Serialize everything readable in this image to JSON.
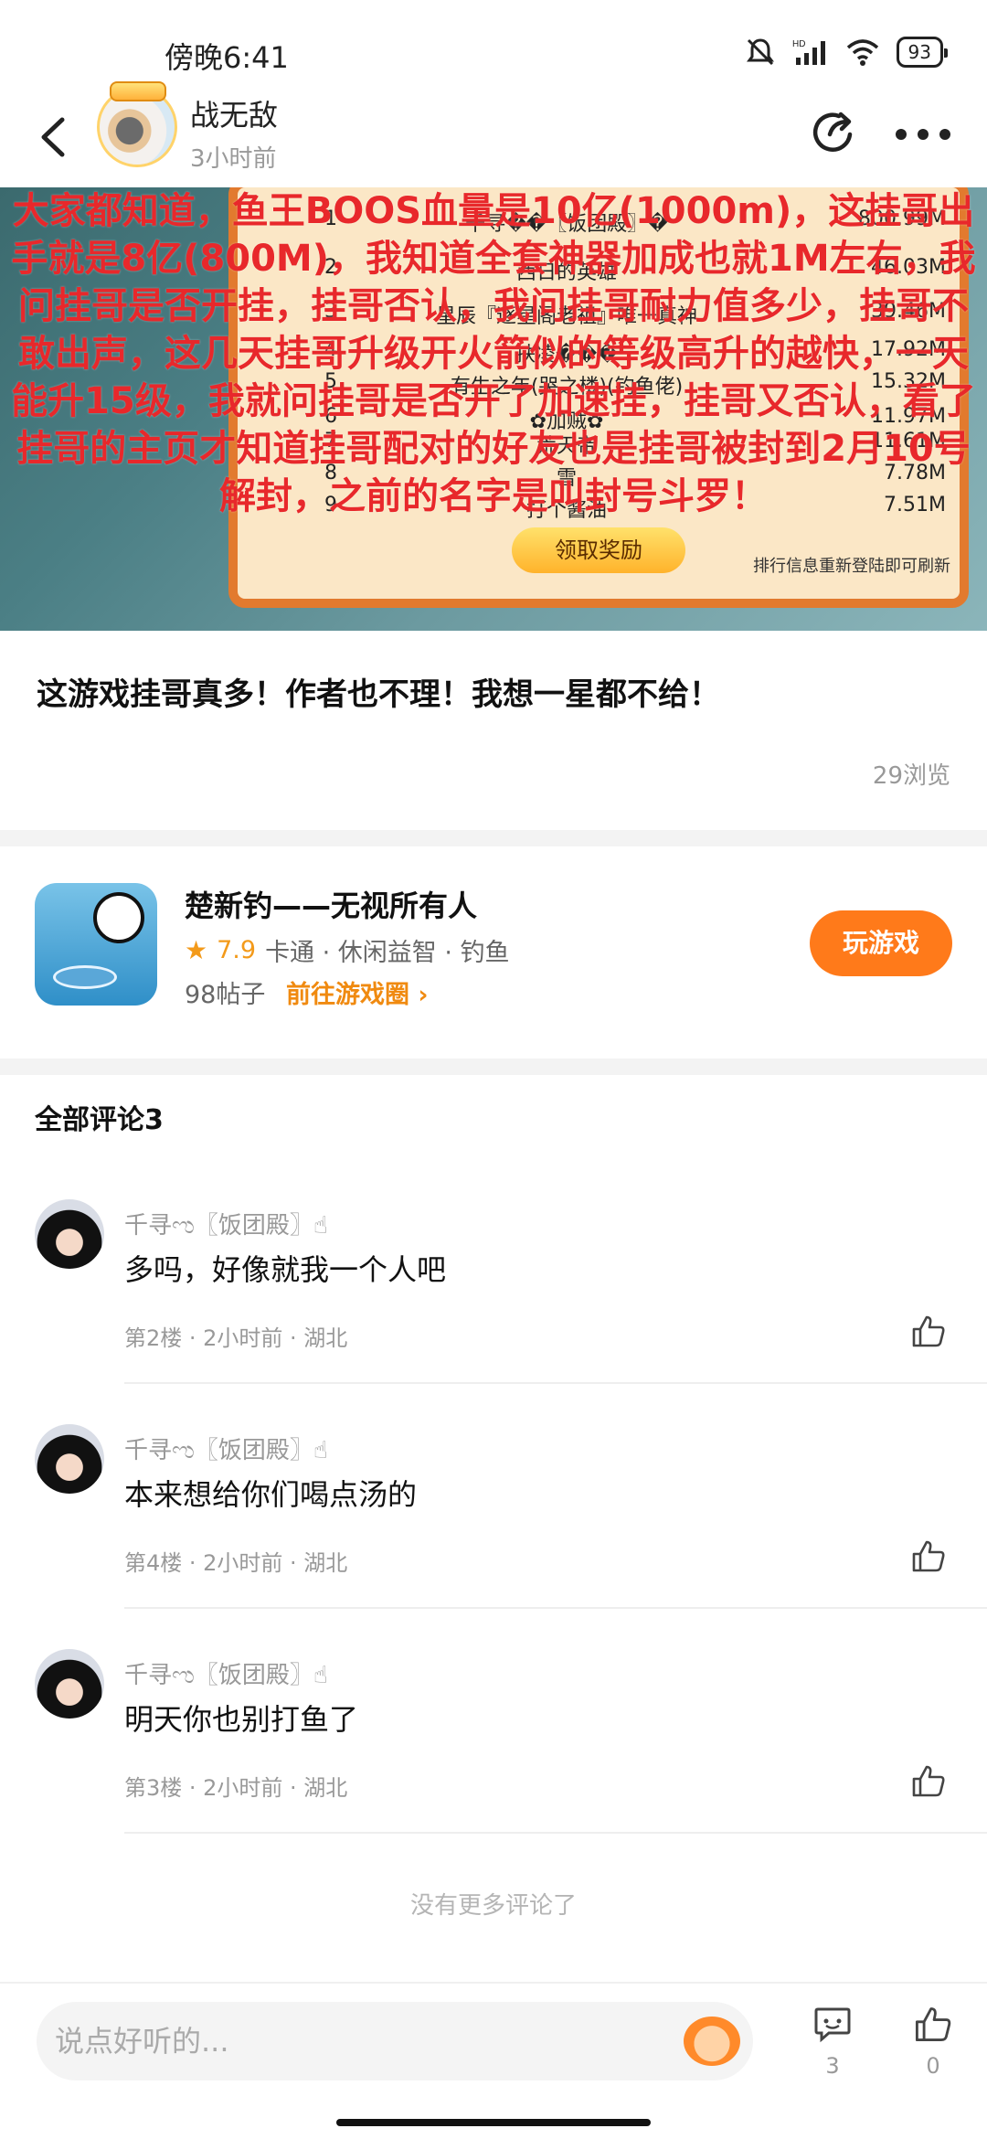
{
  "status_bar": {
    "time": "傍晚6:41",
    "battery": "93",
    "icons": [
      "mute-icon",
      "signal-icon",
      "wifi-icon",
      "battery-icon"
    ]
  },
  "header": {
    "author_name": "战无敌",
    "post_time": "3小时前",
    "icons": [
      "back-icon",
      "share-icon",
      "more-icon"
    ]
  },
  "post": {
    "image": {
      "overlay_text": "大家都知道，鱼王BOOS血量是10亿(1000m)，这挂哥出手就是8亿(800M)，我知道全套神器加成也就1M左右，我问挂哥是否开挂，挂哥否认，我问挂哥耐力值多少，挂哥不敢出声，这几天挂哥升级开火箭似的等级高升的越快，一天能升15级，我就问挂哥是否开了加速挂，挂哥又否认，看了挂哥的主页才知道挂哥配对的好友也是挂哥被封到2月10号解封，之前的名字是叫封号斗罗！",
      "ranking": [
        {
          "rank": "1",
          "name": "千寻��〖饭团殿〗�",
          "value": "800.99M"
        },
        {
          "rank": "2",
          "name": "西日的英雄",
          "value": "46.03M"
        },
        {
          "rank": "3",
          "name": "星辰『逐星阁老祖』唯一真神",
          "value": "39.46M"
        },
        {
          "rank": "4",
          "name": "扶凌���",
          "value": "17.92M"
        },
        {
          "rank": "5",
          "name": "有生之年(哭之楼)(钓鱼佬)",
          "value": "15.32M"
        },
        {
          "rank": "6",
          "name": "✿加贼✿",
          "value": "11.97M"
        },
        {
          "rank": "7",
          "name": "荒天帝",
          "value": "11.61M"
        },
        {
          "rank": "8",
          "name": "雪",
          "value": "7.78M"
        },
        {
          "rank": "9",
          "name": "打个酱油",
          "value": "7.51M"
        }
      ],
      "claim_button": "领取奖励",
      "refresh_note": "排行信息重新登陆即可刷新"
    },
    "title": "这游戏挂哥真多！作者也不理！我想一星都不给！",
    "views": "29浏览"
  },
  "game_card": {
    "name": "楚新钓——无视所有人",
    "rating": "7.9",
    "tags": "卡通 · 休闲益智 · 钓鱼",
    "posts": "98帖子",
    "goto_label": "前往游戏圈",
    "play_label": "玩游戏"
  },
  "comments": {
    "heading": "全部评论3",
    "items": [
      {
        "user": "千寻ಌ〖饭团殿〗☝",
        "text": "多吗，好像就我一个人吧",
        "meta": "第2楼 · 2小时前 · 湖北"
      },
      {
        "user": "千寻ಌ〖饭团殿〗☝",
        "text": "本来想给你们喝点汤的",
        "meta": "第4楼 · 2小时前 · 湖北"
      },
      {
        "user": "千寻ಌ〖饭团殿〗☝",
        "text": "明天你也别打鱼了",
        "meta": "第3楼 · 2小时前 · 湖北"
      }
    ],
    "no_more": "没有更多评论了"
  },
  "bottom_bar": {
    "input_placeholder": "说点好听的...",
    "comment_count": "3",
    "like_count": "0"
  },
  "colors": {
    "accent": "#ff7a1a",
    "link": "#f08a10",
    "overlay_red": "#e8282b"
  }
}
